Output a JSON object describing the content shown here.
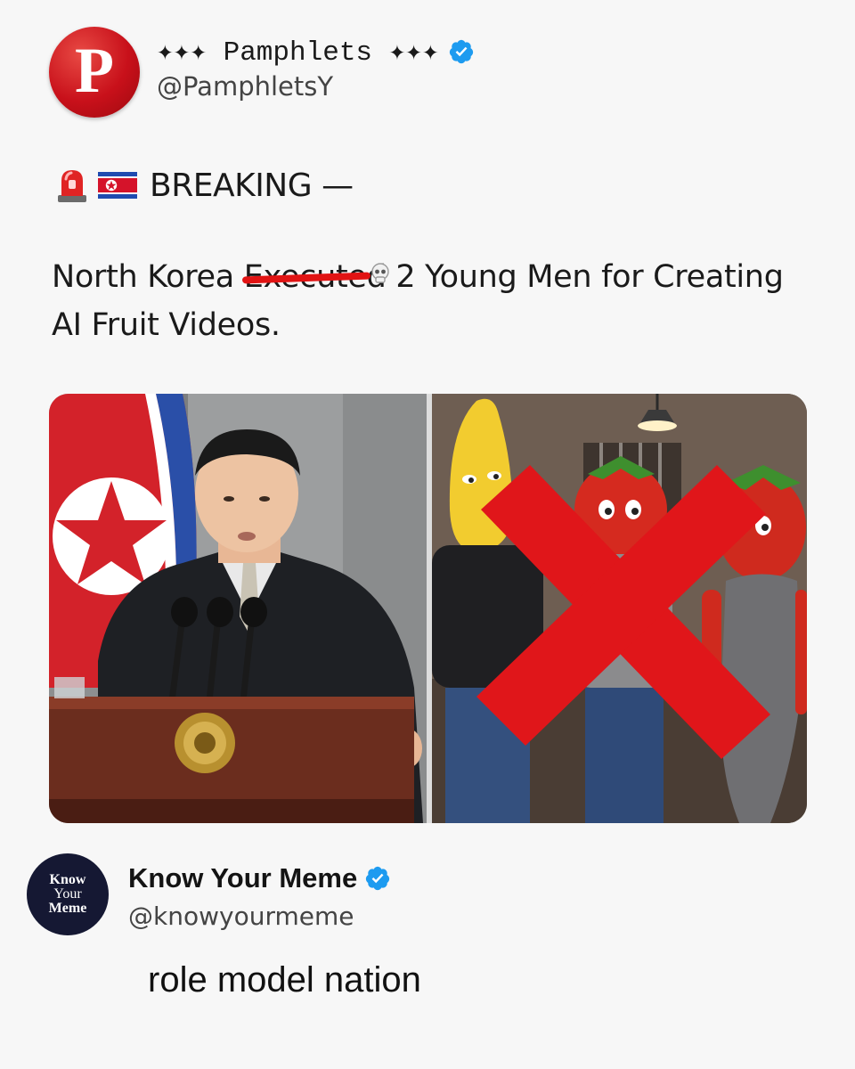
{
  "tweet": {
    "avatar_letter": "P",
    "display_name": "✦✦✦ Pamphlets ✦✦✦",
    "handle": "@PamphletsY",
    "verified": true,
    "breaking_icons": [
      "police-light-icon",
      "north-korea-flag-icon"
    ],
    "breaking_label": "BREAKING —",
    "headline_before": "North Korea ",
    "headline_struck": "Executed",
    "headline_after": " 2 Young Men for Creating AI Fruit Videos.",
    "images": [
      "north-korea-leader-speaking-at-podium",
      "ai-fruit-characters-crossed-out"
    ]
  },
  "quote": {
    "avatar_lines": [
      "Know",
      "Your",
      "Meme"
    ],
    "display_name": "Know Your Meme",
    "handle": "@knowyourmeme",
    "verified": true,
    "caption": "role model nation"
  },
  "colors": {
    "verified_blue": "#1d9bf0",
    "pamphlets_red": "#c8101a",
    "strike_red": "#e11313",
    "kym_navy": "#151833"
  }
}
